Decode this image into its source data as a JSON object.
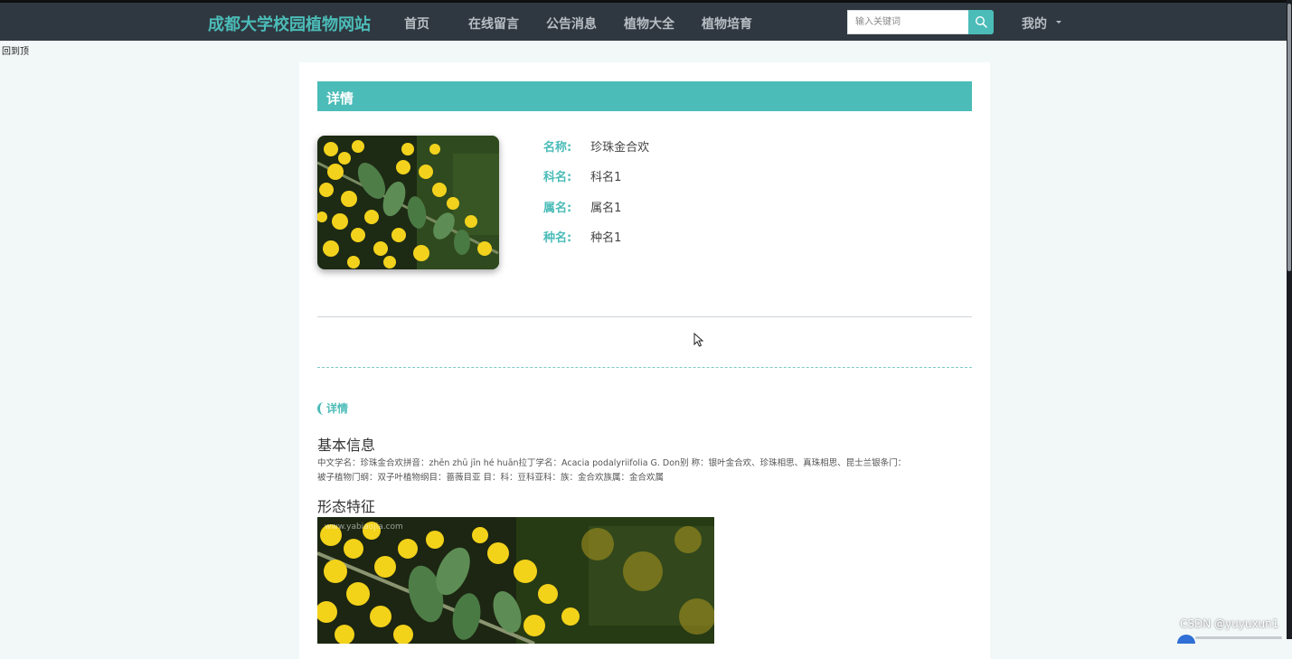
{
  "nav": {
    "brand": "成都大学校园植物网站",
    "links": [
      "首页",
      "在线留言",
      "公告消息",
      "植物大全",
      "植物培育"
    ],
    "search_placeholder": "输入关键词",
    "user_menu": "我的"
  },
  "broken_image_alt": "回到顶",
  "detail": {
    "header": "详情",
    "fields": [
      {
        "label": "名称:",
        "value": "珍珠金合欢"
      },
      {
        "label": "科名:",
        "value": "科名1"
      },
      {
        "label": "属名:",
        "value": "属名1"
      },
      {
        "label": "种名:",
        "value": "种名1"
      }
    ],
    "section_tag": "详情",
    "basic_title": "基本信息",
    "basic_text_line1": "中文学名：珍珠金合欢拼音：zhēn zhū jīn hé huān拉丁学名：Acacia podalyriifolia G. Don别 称：银叶金合欢、珍珠相思、真珠相思、昆士兰银条门：",
    "basic_text_line2": "被子植物门纲：双子叶植物纲目：蔷薇目亚 目：科：豆科亚科：族：金合欢族属：金合欢属",
    "morph_title": "形态特征",
    "image_watermark": "www.yabiaojia.com"
  },
  "footer_watermark": "CSDN @yuyuxun1",
  "colors": {
    "accent": "#4bbcb8",
    "navbar": "#2f3840",
    "page_bg": "#f2f8f8"
  },
  "icons": {
    "search": "search-icon",
    "caret": "chevron-down-icon",
    "pointer": "mouse-pointer-icon"
  }
}
